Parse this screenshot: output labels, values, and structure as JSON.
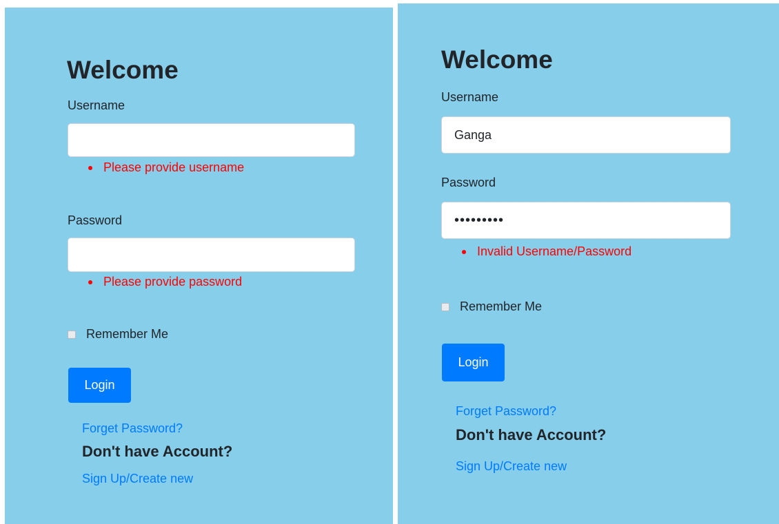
{
  "left": {
    "title": "Welcome",
    "username_label": "Username",
    "username_value": "",
    "username_error": "Please provide username",
    "password_label": "Password",
    "password_value": "",
    "password_error": "Please provide password",
    "remember_label": "Remember Me",
    "login_label": "Login",
    "forgot_link": "Forget Password?",
    "no_account": "Don't have Account?",
    "signup_link": "Sign Up/Create new"
  },
  "right": {
    "title": "Welcome",
    "username_label": "Username",
    "username_value": "Ganga",
    "password_label": "Password",
    "password_value": "•••••••••",
    "password_error": "Invalid Username/Password",
    "remember_label": "Remember Me",
    "login_label": "Login",
    "forgot_link": "Forget Password?",
    "no_account": "Don't have Account?",
    "signup_link": "Sign Up/Create new"
  },
  "colors": {
    "panel_background": "#87ceeb",
    "error": "#ff0000",
    "primary": "#007bff"
  }
}
